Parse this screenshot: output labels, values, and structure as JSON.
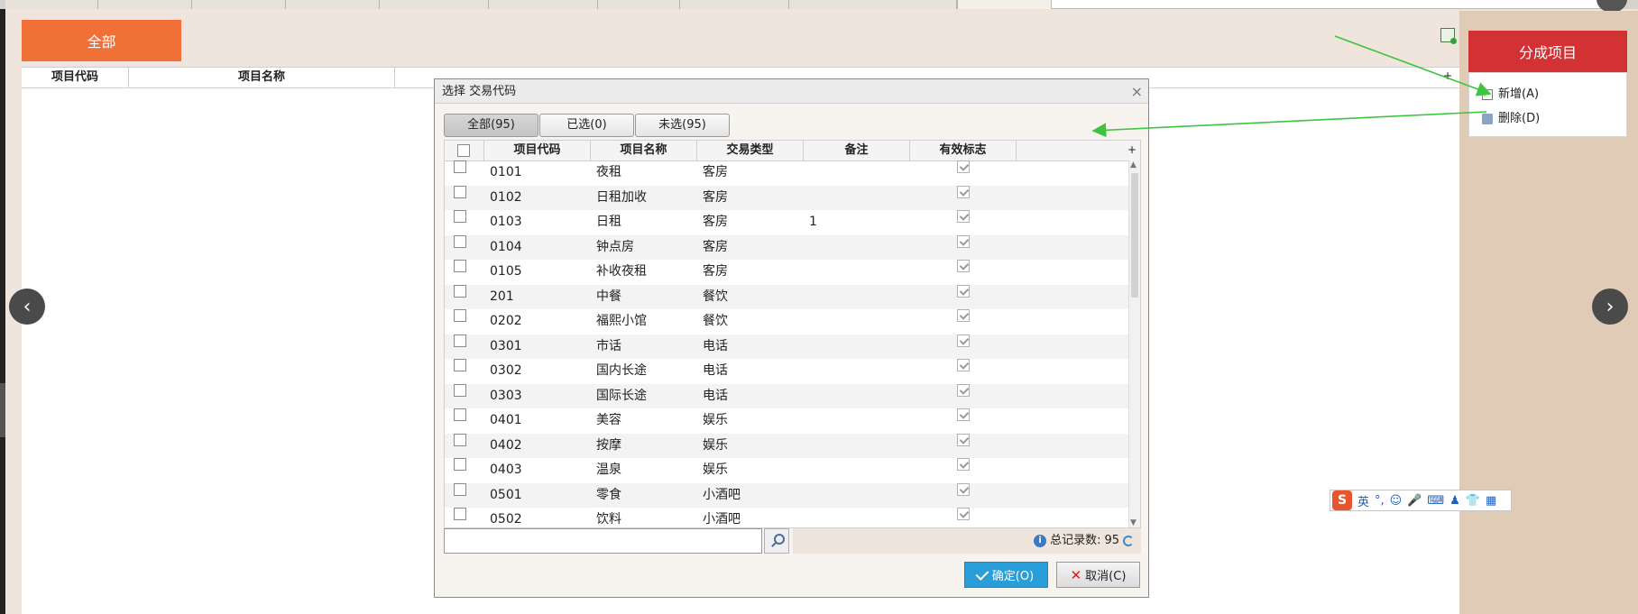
{
  "toolbar": {
    "all_label": "全部"
  },
  "main_grid": {
    "columns": [
      "项目代码",
      "项目名称"
    ],
    "plus": "+"
  },
  "right_panel": {
    "split_label": "分成项目",
    "menu": [
      {
        "label": "新增(A)"
      },
      {
        "label": "删除(D)"
      }
    ]
  },
  "dialog": {
    "title": "选择 交易代码",
    "close": "×",
    "tabs": [
      {
        "label": "全部(95)"
      },
      {
        "label": "已选(0)"
      },
      {
        "label": "未选(95)"
      }
    ],
    "columns": [
      "项目代码",
      "项目名称",
      "交易类型",
      "备注",
      "有效标志"
    ],
    "plus": "+",
    "rows": [
      {
        "code": "0101",
        "name": "夜租",
        "type": "客房",
        "note": ""
      },
      {
        "code": "0102",
        "name": "日租加收",
        "type": "客房",
        "note": ""
      },
      {
        "code": "0103",
        "name": "日租",
        "type": "客房",
        "note": "1"
      },
      {
        "code": "0104",
        "name": "钟点房",
        "type": "客房",
        "note": ""
      },
      {
        "code": "0105",
        "name": "补收夜租",
        "type": "客房",
        "note": ""
      },
      {
        "code": "201",
        "name": "中餐",
        "type": "餐饮",
        "note": ""
      },
      {
        "code": "0202",
        "name": "福熙小馆",
        "type": "餐饮",
        "note": ""
      },
      {
        "code": "0301",
        "name": "市话",
        "type": "电话",
        "note": ""
      },
      {
        "code": "0302",
        "name": "国内长途",
        "type": "电话",
        "note": ""
      },
      {
        "code": "0303",
        "name": "国际长途",
        "type": "电话",
        "note": ""
      },
      {
        "code": "0401",
        "name": "美容",
        "type": "娱乐",
        "note": ""
      },
      {
        "code": "0402",
        "name": "按摩",
        "type": "娱乐",
        "note": ""
      },
      {
        "code": "0403",
        "name": "温泉",
        "type": "娱乐",
        "note": ""
      },
      {
        "code": "0501",
        "name": "零食",
        "type": "小酒吧",
        "note": ""
      },
      {
        "code": "0502",
        "name": "饮料",
        "type": "小酒吧",
        "note": ""
      }
    ],
    "search": {
      "value": "",
      "placeholder": ""
    },
    "records_label": "总记录数:",
    "records_count": "95",
    "ok_label": "确定(O)",
    "cancel_label": "取消(C)"
  },
  "ime": {
    "logo": "S",
    "lang": "英",
    "punct": "°,"
  },
  "colors": {
    "orange": "#f07038",
    "red": "#d23233",
    "blue": "#2a9ed8",
    "arrow": "#3ec43e"
  }
}
